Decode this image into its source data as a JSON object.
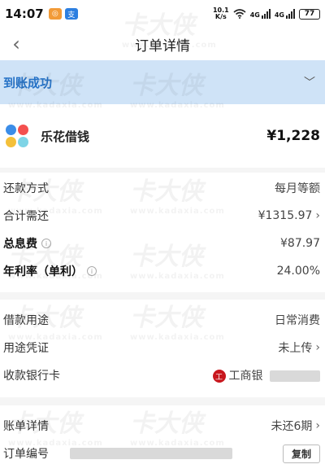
{
  "status_bar": {
    "time": "14:07",
    "net_speed_top": "10.1",
    "net_speed_bottom": "K/s",
    "sim1_label": "4G",
    "sim2_label": "4G",
    "battery": "77"
  },
  "nav": {
    "back_icon": "chevron-left-icon",
    "title": "订单详情"
  },
  "status_banner": {
    "text": "到账成功",
    "color": "#2773c7",
    "background": "#cfe3f7"
  },
  "merchant": {
    "name": "乐花借钱",
    "amount": "¥1,228"
  },
  "repayment": {
    "method_label": "还款方式",
    "method_value": "每月等额",
    "total_label": "合计需还",
    "total_value": "¥1315.97",
    "interest_label": "总息费",
    "interest_value": "¥87.97",
    "rate_label": "年利率（单利）",
    "rate_value": "24.00%"
  },
  "loan": {
    "purpose_label": "借款用途",
    "purpose_value": "日常消费",
    "proof_label": "用途凭证",
    "proof_value": "未上传",
    "bank_label": "收款银行卡",
    "bank_value": "工商银"
  },
  "bill": {
    "detail_label": "账单详情",
    "detail_value": "未还6期",
    "order_label": "订单编号",
    "copy_label": "复制"
  },
  "watermark": {
    "text": "卡大侠",
    "url": "www.kadaxia.com"
  }
}
